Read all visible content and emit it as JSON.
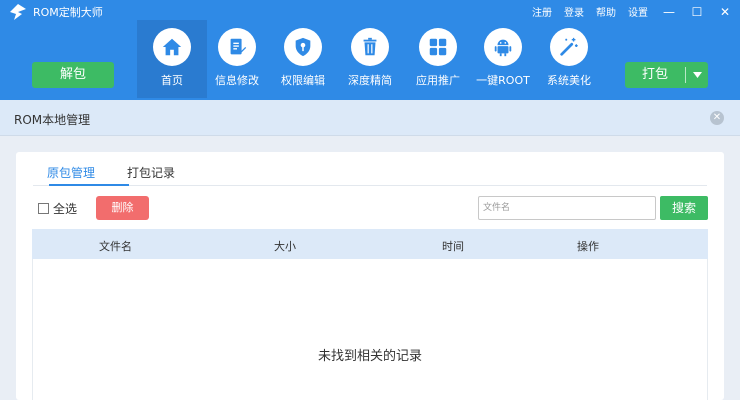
{
  "app": {
    "title": "ROM定制大师"
  },
  "winlinks": {
    "register": "注册",
    "login": "登录",
    "help": "帮助",
    "settings": "设置",
    "minimize": "—",
    "maximize": "☐",
    "close": "✕"
  },
  "toolbar": {
    "unpack_label": "解包",
    "pack_label": "打包",
    "nav": [
      {
        "label": "首页",
        "icon": "home-icon",
        "active": true
      },
      {
        "label": "信息修改",
        "icon": "edit-doc-icon"
      },
      {
        "label": "权限编辑",
        "icon": "shield-key-icon"
      },
      {
        "label": "深度精简",
        "icon": "trash-icon"
      },
      {
        "label": "应用推广",
        "icon": "apps-grid-icon"
      },
      {
        "label": "一键ROOT",
        "icon": "android-icon"
      },
      {
        "label": "系统美化",
        "icon": "magic-wand-icon"
      }
    ]
  },
  "panel": {
    "title": "ROM本地管理",
    "close": "✕"
  },
  "tabs": [
    {
      "label": "原包管理",
      "active": true
    },
    {
      "label": "打包记录"
    }
  ],
  "actions": {
    "select_all": "全选",
    "delete": "删除",
    "search_placeholder": "文件名",
    "search_button": "搜索"
  },
  "table": {
    "columns": [
      "文件名",
      "大小",
      "时间",
      "操作"
    ],
    "empty_text": "未找到相关的记录"
  },
  "colors": {
    "header_blue": "#2f8ae6",
    "green": "#3dbb64",
    "red": "#f26d6d",
    "table_header": "#dce9f8"
  }
}
